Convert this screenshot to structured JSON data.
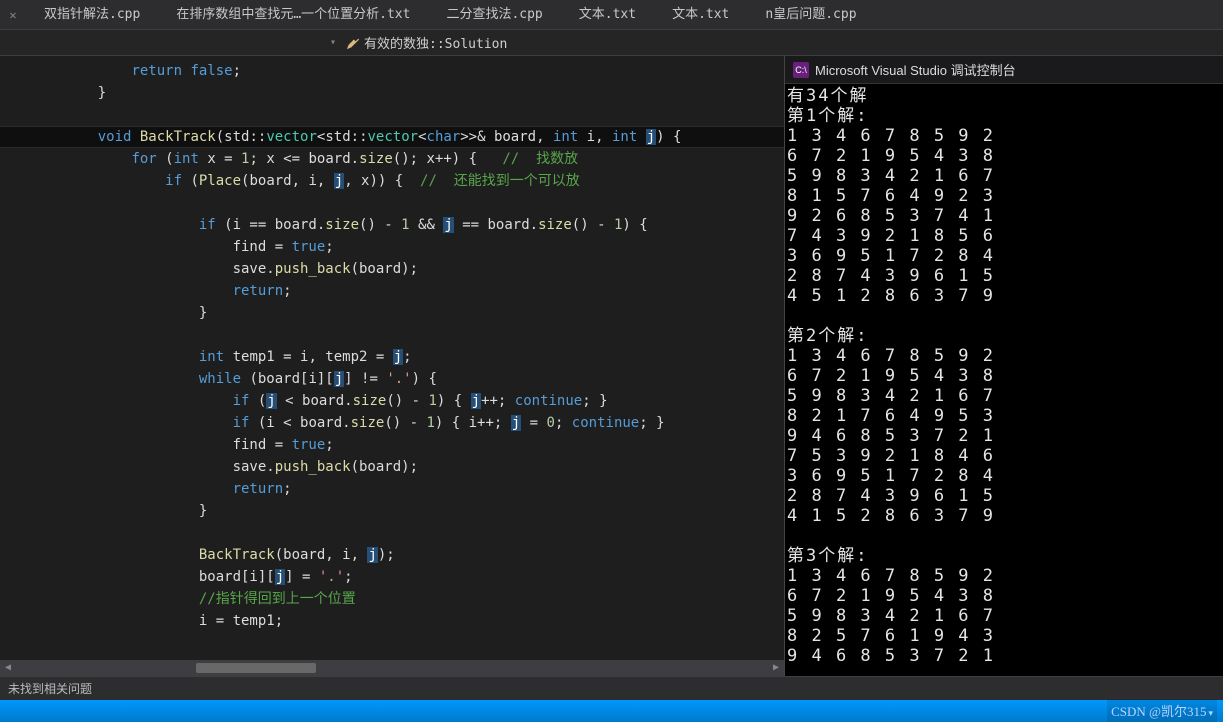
{
  "tabs": [
    "双指针解法.cpp",
    "在排序数组中查找元…一个位置分析.txt",
    "二分查找法.cpp",
    "文本.txt",
    "文本.txt",
    "n皇后问题.cpp"
  ],
  "nav": {
    "sep": "▾",
    "scope": "有效的数独::Solution"
  },
  "code_lines": [
    {
      "i": 0,
      "t": "        return false;",
      "c": "plain"
    },
    {
      "i": 0,
      "t": "    }",
      "c": "plain"
    },
    {
      "i": 0,
      "t": "",
      "c": "plain"
    },
    {
      "i": 0,
      "t": "    void BackTrack(std::vector<std::vector<char>>& board, int i, int j) {",
      "c": "sig",
      "hl": true
    },
    {
      "i": 0,
      "t": "        for (int x = 1; x <= board.size(); x++) {   //  找数放",
      "c": "for"
    },
    {
      "i": 0,
      "t": "            if (Place(board, i, j, x)) {  //  还能找到一个可以放",
      "c": "if1"
    },
    {
      "i": 0,
      "t": "",
      "c": "plain"
    },
    {
      "i": 0,
      "t": "                if (i == board.size() - 1 && j == board.size() - 1) {",
      "c": "if2"
    },
    {
      "i": 0,
      "t": "                    find = true;",
      "c": "asn"
    },
    {
      "i": 0,
      "t": "                    save.push_back(board);",
      "c": "call"
    },
    {
      "i": 0,
      "t": "                    return;",
      "c": "ret"
    },
    {
      "i": 0,
      "t": "                }",
      "c": "plain"
    },
    {
      "i": 0,
      "t": "",
      "c": "plain"
    },
    {
      "i": 0,
      "t": "                int temp1 = i, temp2 = j;",
      "c": "decl"
    },
    {
      "i": 0,
      "t": "                while (board[i][j] != '.') {",
      "c": "while"
    },
    {
      "i": 0,
      "t": "                    if (j < board.size() - 1) { j++; continue; }",
      "c": "if3"
    },
    {
      "i": 0,
      "t": "                    if (i < board.size() - 1) { i++; j = 0; continue; }",
      "c": "if4"
    },
    {
      "i": 0,
      "t": "                    find = true;",
      "c": "asn"
    },
    {
      "i": 0,
      "t": "                    save.push_back(board);",
      "c": "call"
    },
    {
      "i": 0,
      "t": "                    return;",
      "c": "ret"
    },
    {
      "i": 0,
      "t": "                }",
      "c": "plain"
    },
    {
      "i": 0,
      "t": "",
      "c": "plain"
    },
    {
      "i": 0,
      "t": "                BackTrack(board, i, j);",
      "c": "rec"
    },
    {
      "i": 0,
      "t": "                board[i][j] = '.';",
      "c": "asn2"
    },
    {
      "i": 0,
      "t": "                //指针得回到上一个位置",
      "c": "cmt"
    },
    {
      "i": 0,
      "t": "                i = temp1;",
      "c": "asn3"
    }
  ],
  "console": {
    "title": "Microsoft Visual Studio 调试控制台",
    "lines": [
      "有34个解",
      "第1个解:",
      "1 3 4 6 7 8 5 9 2",
      "6 7 2 1 9 5 4 3 8",
      "5 9 8 3 4 2 1 6 7",
      "8 1 5 7 6 4 9 2 3",
      "9 2 6 8 5 3 7 4 1",
      "7 4 3 9 2 1 8 5 6",
      "3 6 9 5 1 7 2 8 4",
      "2 8 7 4 3 9 6 1 5",
      "4 5 1 2 8 6 3 7 9",
      "",
      "第2个解:",
      "1 3 4 6 7 8 5 9 2",
      "6 7 2 1 9 5 4 3 8",
      "5 9 8 3 4 2 1 6 7",
      "8 2 1 7 6 4 9 5 3",
      "9 4 6 8 5 3 7 2 1",
      "7 5 3 9 2 1 8 4 6",
      "3 6 9 5 1 7 2 8 4",
      "2 8 7 4 3 9 6 1 5",
      "4 1 5 2 8 6 3 7 9",
      "",
      "第3个解:",
      "1 3 4 6 7 8 5 9 2",
      "6 7 2 1 9 5 4 3 8",
      "5 9 8 3 4 2 1 6 7",
      "8 2 5 7 6 1 9 4 3",
      "9 4 6 8 5 3 7 2 1"
    ]
  },
  "status": {
    "text": "未找到相关问题"
  },
  "watermark": "CSDN @凯尔315"
}
